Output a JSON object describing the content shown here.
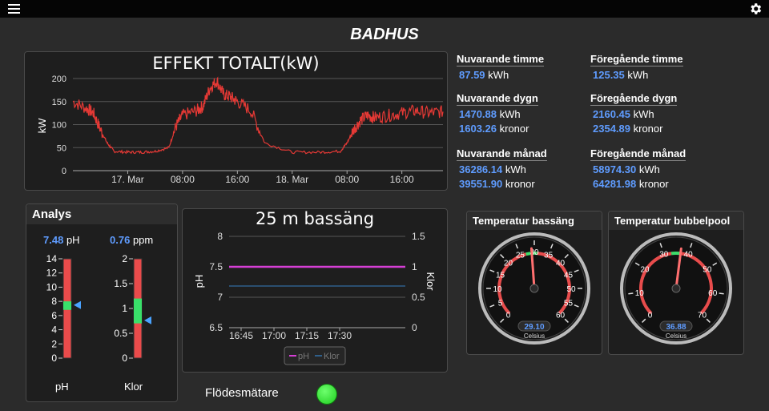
{
  "header": {
    "menu_icon": "hamburger-menu-icon",
    "settings_icon": "gear-icon"
  },
  "page_title": "BADHUS",
  "effekt_chart": {
    "title": "EFFEKT TOTALT(kW)",
    "ylabel": "kW",
    "y_ticks": [
      "0",
      "50",
      "100",
      "150",
      "200"
    ],
    "x_ticks": [
      "17. Mar",
      "08:00",
      "16:00",
      "18. Mar",
      "08:00",
      "16:00"
    ],
    "line_color": "#e53935"
  },
  "chart_data": [
    {
      "type": "line",
      "title": "EFFEKT TOTALT(kW)",
      "ylabel": "kW",
      "ylim": [
        0,
        200
      ],
      "x_hours_from_midnight_16_mar": [
        16,
        18,
        19,
        20,
        21,
        22,
        24,
        26,
        28,
        30,
        31,
        32,
        34,
        35,
        36,
        37,
        38,
        39,
        40,
        42,
        44,
        48,
        52,
        55,
        56,
        57,
        58,
        59,
        60,
        62,
        64,
        66,
        68,
        70
      ],
      "series": [
        {
          "name": "kW",
          "values": [
            150,
            135,
            125,
            90,
            60,
            42,
            40,
            40,
            42,
            50,
            95,
            120,
            130,
            140,
            180,
            195,
            165,
            160,
            150,
            130,
            60,
            40,
            40,
            42,
            60,
            90,
            110,
            120,
            115,
            120,
            125,
            130,
            125,
            128
          ]
        }
      ]
    },
    {
      "type": "line",
      "title": "25 m bassäng",
      "ylabel": "pH",
      "y2label": "Klor",
      "ylim": [
        6.5,
        8
      ],
      "y2lim": [
        0,
        1.5
      ],
      "x": [
        "16:45",
        "17:00",
        "17:15",
        "17:30"
      ],
      "series": [
        {
          "name": "pH",
          "values": [
            7.5,
            7.5,
            7.5,
            7.5
          ]
        },
        {
          "name": "Klor",
          "values": [
            0.75,
            0.75,
            0.75,
            0.75
          ]
        }
      ]
    }
  ],
  "stats": [
    {
      "head": "Nuvarande timme",
      "rows": [
        {
          "value": "87.59",
          "unit": "kWh"
        }
      ]
    },
    {
      "head": "Föregående timme",
      "rows": [
        {
          "value": "125.35",
          "unit": "kWh"
        }
      ]
    },
    {
      "head": "Nuvarande dygn",
      "rows": [
        {
          "value": "1470.88",
          "unit": "kWh"
        },
        {
          "value": "1603.26",
          "unit": "kronor"
        }
      ]
    },
    {
      "head": "Föregående dygn",
      "rows": [
        {
          "value": "2160.45",
          "unit": "kWh"
        },
        {
          "value": "2354.89",
          "unit": "kronor"
        }
      ]
    },
    {
      "head": "Nuvarande månad",
      "rows": [
        {
          "value": "36286.14",
          "unit": "kWh"
        },
        {
          "value": "39551.90",
          "unit": "kronor"
        }
      ]
    },
    {
      "head": "Föregående månad",
      "rows": [
        {
          "value": "58974.30",
          "unit": "kWh"
        },
        {
          "value": "64281.98",
          "unit": "kronor"
        }
      ]
    }
  ],
  "analys": {
    "title": "Analys",
    "ph": {
      "value": "7.48",
      "unit": "pH",
      "label": "pH",
      "ticks": [
        "0",
        "2",
        "4",
        "6",
        "8",
        "10",
        "12",
        "14"
      ],
      "min": 0,
      "max": 14,
      "green_from": 6.8,
      "green_to": 8,
      "reading": 7.48
    },
    "klor": {
      "value": "0.76",
      "unit": "ppm",
      "label": "Klor",
      "ticks": [
        "0",
        "0.5",
        "1",
        "1.5",
        "2"
      ],
      "min": 0,
      "max": 2,
      "green_from": 0.7,
      "green_to": 1.2,
      "reading": 0.76
    }
  },
  "bassang_chart": {
    "title": "25 m bassäng",
    "ylabel": "pH",
    "y2label": "Klor",
    "y_ticks": [
      "6.5",
      "7",
      "7.5",
      "8"
    ],
    "y2_ticks": [
      "0",
      "0.5",
      "1",
      "1.5"
    ],
    "x_ticks": [
      "16:45",
      "17:00",
      "17:15",
      "17:30"
    ],
    "legend": [
      "pH",
      "Klor"
    ],
    "ph_color": "#d63fd6",
    "klor_color": "#2f5f8a"
  },
  "gauges": [
    {
      "title": "Temperatur bassäng",
      "value": "29.10",
      "unit": "Celsius",
      "min": 0,
      "max": 60,
      "reading": 29.1,
      "ticks": [
        "0",
        "5",
        "10",
        "15",
        "20",
        "25",
        "30",
        "35",
        "40",
        "45",
        "50",
        "55",
        "60"
      ],
      "green_from": 27,
      "green_to": 31
    },
    {
      "title": "Temperatur bubbelpool",
      "value": "36.88",
      "unit": "Celsius",
      "min": 0,
      "max": 70,
      "reading": 36.88,
      "ticks": [
        "0",
        "10",
        "20",
        "30",
        "40",
        "50",
        "60",
        "70"
      ],
      "green_from": 33,
      "green_to": 37
    }
  ],
  "flow": {
    "label": "Flödesmätare",
    "status_color": "#33dd33"
  }
}
